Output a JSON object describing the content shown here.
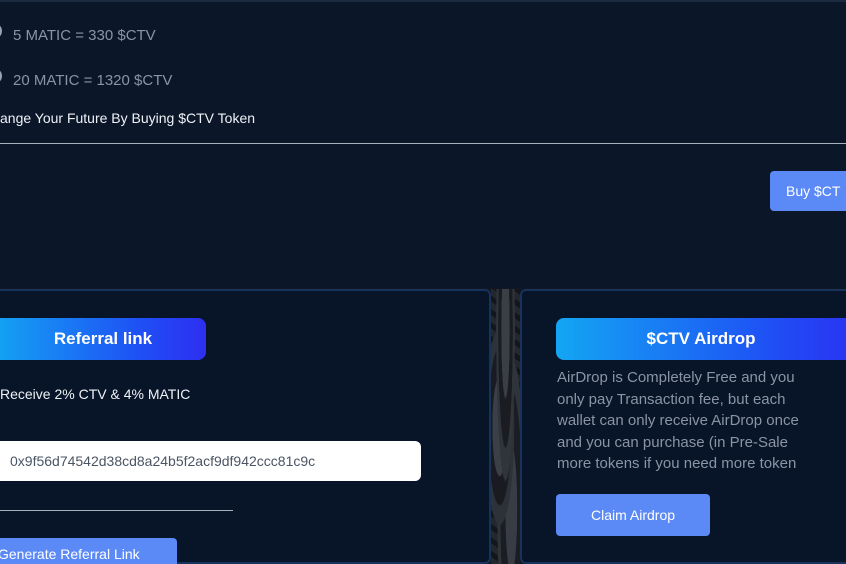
{
  "presale": {
    "options": [
      {
        "label": "5 MATIC = 330 $CTV"
      },
      {
        "label": "20 MATIC = 1320 $CTV"
      }
    ],
    "tagline": "ange Your Future By Buying $CTV Token",
    "buy_button": "Buy $CT"
  },
  "referral": {
    "title": "Referral link",
    "reward_text": "Receive 2% CTV & 4% MATIC",
    "link_value": "0x9f56d74542d38cd8a24b5f2acf9df942ccc81c9c",
    "generate_button": "Generate Referral Link"
  },
  "airdrop": {
    "title": "$CTV Airdrop",
    "description": "AirDrop is Completely Free and you\nonly pay Transaction fee, but each\nwallet can only receive AirDrop once\nand you can purchase (in Pre-Sale\nmore tokens if you need more token",
    "claim_button": "Claim Airdrop"
  },
  "colors": {
    "background": "#0b1628",
    "card_border": "#17335c",
    "button": "#5b8af7",
    "header_gradient_start": "#13a6f3",
    "header_gradient_end": "#2d2ff0"
  }
}
